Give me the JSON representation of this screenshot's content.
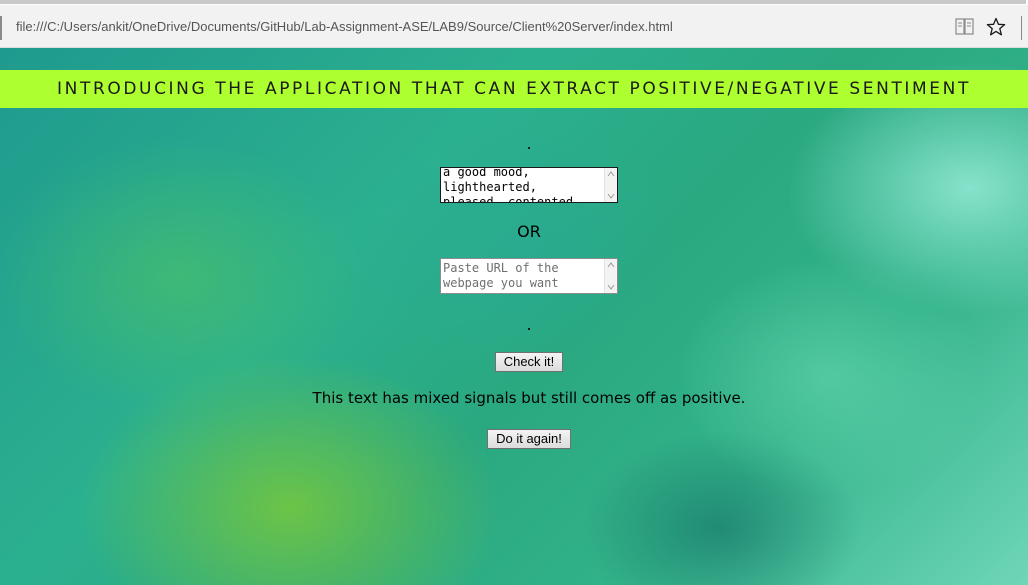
{
  "browser": {
    "address": "file:///C:/Users/ankit/OneDrive/Documents/GitHub/Lab-Assignment-ASE/LAB9/Source/Client%20Server/index.html",
    "icons": [
      "reading-view-icon",
      "favorite-star-icon"
    ]
  },
  "page": {
    "banner_title": "INTRODUCING THE APPLICATION THAT CAN EXTRACT POSITIVE/NEGATIVE SENTIMENT",
    "dot_top": ".",
    "text_input_value": "a good mood,\nlighthearted,\npleased, contented,",
    "or_label": "OR",
    "url_input_placeholder": "Paste URL of the\nwebpage you want",
    "dot_bottom": ".",
    "check_button_label": "Check it!",
    "result_text": "This text has mixed signals but still comes off as positive.",
    "again_button_label": "Do it again!"
  },
  "colors": {
    "banner_bg": "#adff2f",
    "background_primary": "#2aa88c"
  }
}
